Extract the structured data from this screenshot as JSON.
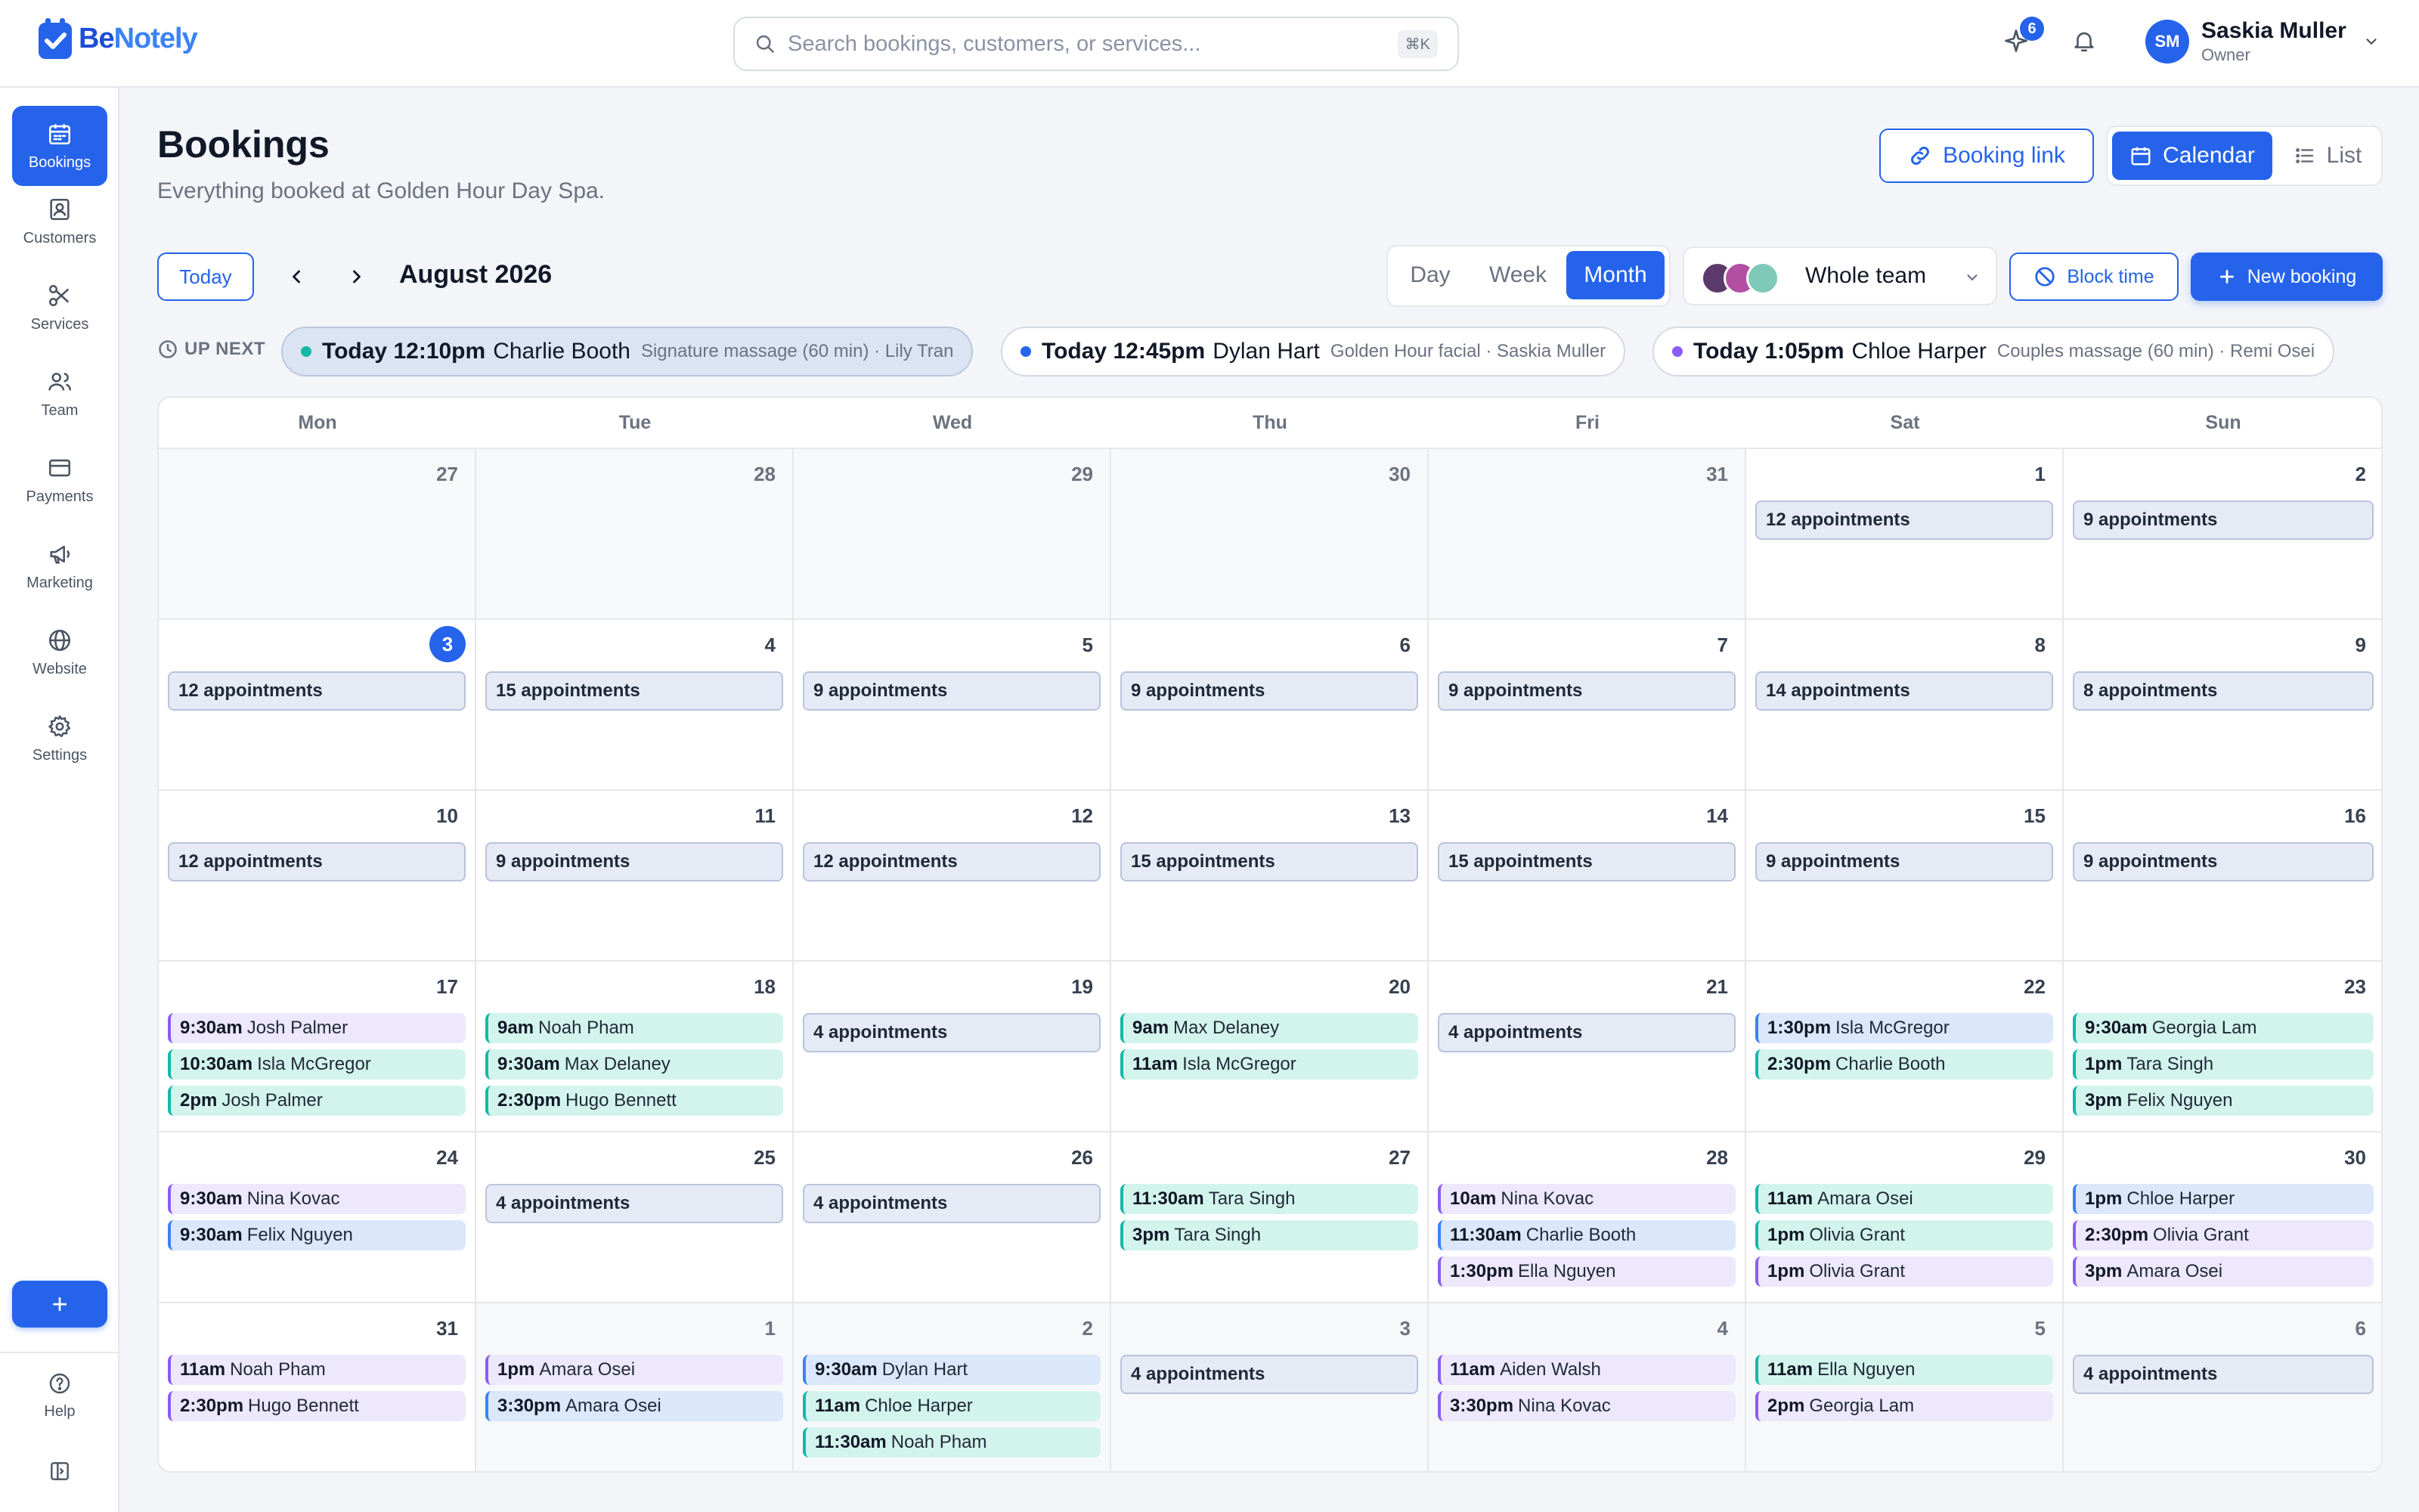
{
  "app": {
    "name_be": "Be",
    "name_notely": "Notely"
  },
  "search": {
    "placeholder": "Search bookings, customers, or services...",
    "shortcut": "⌘K"
  },
  "topbar": {
    "notification_count": "6"
  },
  "user": {
    "initials": "SM",
    "name": "Saskia Muller",
    "role": "Owner"
  },
  "sidebar": {
    "items": [
      {
        "label": "Bookings",
        "icon": "calendar-icon",
        "active": true
      },
      {
        "label": "Customers",
        "icon": "contact-card-icon"
      },
      {
        "label": "Services",
        "icon": "scissors-icon"
      },
      {
        "label": "Team",
        "icon": "users-icon"
      },
      {
        "label": "Payments",
        "icon": "credit-card-icon"
      },
      {
        "label": "Marketing",
        "icon": "megaphone-icon"
      },
      {
        "label": "Website",
        "icon": "globe-icon"
      },
      {
        "label": "Settings",
        "icon": "gear-icon"
      }
    ],
    "add_label": "+",
    "help_label": "Help"
  },
  "header": {
    "title": "Bookings",
    "subtitle": "Everything booked at Golden Hour Day Spa.",
    "booking_link": "Booking link",
    "view_calendar": "Calendar",
    "view_list": "List"
  },
  "toolbar": {
    "today": "Today",
    "month_label": "August 2026",
    "views": [
      "Day",
      "Week",
      "Month"
    ],
    "active_view": "Month",
    "team": "Whole team",
    "block_time": "Block time",
    "new_booking": "New booking"
  },
  "up_next": {
    "label": "UP NEXT",
    "items": [
      {
        "when": "Today 12:10pm",
        "who": "Charlie Booth",
        "what": "Signature massage (60 min) · Lily Tran",
        "color": "#14b8a6"
      },
      {
        "when": "Today 12:45pm",
        "who": "Dylan Hart",
        "what": "Golden Hour facial · Saskia Muller",
        "color": "#2563eb"
      },
      {
        "when": "Today 1:05pm",
        "who": "Chloe Harper",
        "what": "Couples massage (60 min) · Remi Osei",
        "color": "#8b5cf6"
      }
    ]
  },
  "calendar": {
    "weekdays": [
      "Mon",
      "Tue",
      "Wed",
      "Thu",
      "Fri",
      "Sat",
      "Sun"
    ],
    "weeks": [
      [
        {
          "day": "27",
          "muted": true
        },
        {
          "day": "28",
          "muted": true
        },
        {
          "day": "29",
          "muted": true
        },
        {
          "day": "30",
          "muted": true
        },
        {
          "day": "31",
          "muted": true
        },
        {
          "day": "1",
          "count": "12 appointments"
        },
        {
          "day": "2",
          "count": "9 appointments"
        }
      ],
      [
        {
          "day": "3",
          "today": true,
          "count": "12 appointments"
        },
        {
          "day": "4",
          "count": "15 appointments"
        },
        {
          "day": "5",
          "count": "9 appointments"
        },
        {
          "day": "6",
          "count": "9 appointments"
        },
        {
          "day": "7",
          "count": "9 appointments"
        },
        {
          "day": "8",
          "count": "14 appointments"
        },
        {
          "day": "9",
          "count": "8 appointments"
        }
      ],
      [
        {
          "day": "10",
          "count": "12 appointments"
        },
        {
          "day": "11",
          "count": "9 appointments"
        },
        {
          "day": "12",
          "count": "12 appointments"
        },
        {
          "day": "13",
          "count": "15 appointments"
        },
        {
          "day": "14",
          "count": "15 appointments"
        },
        {
          "day": "15",
          "count": "9 appointments"
        },
        {
          "day": "16",
          "count": "9 appointments"
        }
      ],
      [
        {
          "day": "17",
          "events": [
            {
              "time": "9:30am",
              "name": "Josh Palmer",
              "color": "purple"
            },
            {
              "time": "10:30am",
              "name": "Isla McGregor",
              "color": "teal"
            },
            {
              "time": "2pm",
              "name": "Josh Palmer",
              "color": "teal"
            }
          ]
        },
        {
          "day": "18",
          "events": [
            {
              "time": "9am",
              "name": "Noah Pham",
              "color": "teal"
            },
            {
              "time": "9:30am",
              "name": "Max Delaney",
              "color": "teal"
            },
            {
              "time": "2:30pm",
              "name": "Hugo Bennett",
              "color": "teal"
            }
          ]
        },
        {
          "day": "19",
          "count": "4 appointments"
        },
        {
          "day": "20",
          "events": [
            {
              "time": "9am",
              "name": "Max Delaney",
              "color": "teal"
            },
            {
              "time": "11am",
              "name": "Isla McGregor",
              "color": "teal"
            }
          ]
        },
        {
          "day": "21",
          "count": "4 appointments"
        },
        {
          "day": "22",
          "events": [
            {
              "time": "1:30pm",
              "name": "Isla McGregor",
              "color": "blue"
            },
            {
              "time": "2:30pm",
              "name": "Charlie Booth",
              "color": "teal"
            }
          ]
        },
        {
          "day": "23",
          "events": [
            {
              "time": "9:30am",
              "name": "Georgia Lam",
              "color": "teal"
            },
            {
              "time": "1pm",
              "name": "Tara Singh",
              "color": "teal"
            },
            {
              "time": "3pm",
              "name": "Felix Nguyen",
              "color": "teal"
            }
          ]
        }
      ],
      [
        {
          "day": "24",
          "events": [
            {
              "time": "9:30am",
              "name": "Nina Kovac",
              "color": "purple"
            },
            {
              "time": "9:30am",
              "name": "Felix Nguyen",
              "color": "blue"
            }
          ]
        },
        {
          "day": "25",
          "count": "4 appointments"
        },
        {
          "day": "26",
          "count": "4 appointments"
        },
        {
          "day": "27",
          "events": [
            {
              "time": "11:30am",
              "name": "Tara Singh",
              "color": "teal"
            },
            {
              "time": "3pm",
              "name": "Tara Singh",
              "color": "teal"
            }
          ]
        },
        {
          "day": "28",
          "events": [
            {
              "time": "10am",
              "name": "Nina Kovac",
              "color": "purple"
            },
            {
              "time": "11:30am",
              "name": "Charlie Booth",
              "color": "blue"
            },
            {
              "time": "1:30pm",
              "name": "Ella Nguyen",
              "color": "purple"
            }
          ]
        },
        {
          "day": "29",
          "events": [
            {
              "time": "11am",
              "name": "Amara Osei",
              "color": "teal"
            },
            {
              "time": "1pm",
              "name": "Olivia Grant",
              "color": "teal"
            },
            {
              "time": "1pm",
              "name": "Olivia Grant",
              "color": "purple"
            }
          ]
        },
        {
          "day": "30",
          "events": [
            {
              "time": "1pm",
              "name": "Chloe Harper",
              "color": "blue"
            },
            {
              "time": "2:30pm",
              "name": "Olivia Grant",
              "color": "purple"
            },
            {
              "time": "3pm",
              "name": "Amara Osei",
              "color": "purple"
            }
          ]
        }
      ],
      [
        {
          "day": "31",
          "events": [
            {
              "time": "11am",
              "name": "Noah Pham",
              "color": "purple"
            },
            {
              "time": "2:30pm",
              "name": "Hugo Bennett",
              "color": "purple"
            }
          ]
        },
        {
          "day": "1",
          "muted": true,
          "events": [
            {
              "time": "1pm",
              "name": "Amara Osei",
              "color": "purple"
            },
            {
              "time": "3:30pm",
              "name": "Amara Osei",
              "color": "blue"
            }
          ]
        },
        {
          "day": "2",
          "muted": true,
          "events": [
            {
              "time": "9:30am",
              "name": "Dylan Hart",
              "color": "blue"
            },
            {
              "time": "11am",
              "name": "Chloe Harper",
              "color": "teal"
            },
            {
              "time": "11:30am",
              "name": "Noah Pham",
              "color": "teal"
            }
          ]
        },
        {
          "day": "3",
          "muted": true,
          "count": "4 appointments"
        },
        {
          "day": "4",
          "muted": true,
          "events": [
            {
              "time": "11am",
              "name": "Aiden Walsh",
              "color": "purple"
            },
            {
              "time": "3:30pm",
              "name": "Nina Kovac",
              "color": "purple"
            }
          ]
        },
        {
          "day": "5",
          "muted": true,
          "events": [
            {
              "time": "11am",
              "name": "Ella Nguyen",
              "color": "teal"
            },
            {
              "time": "2pm",
              "name": "Georgia Lam",
              "color": "purple"
            }
          ]
        },
        {
          "day": "6",
          "muted": true,
          "count": "4 appointments"
        }
      ]
    ]
  },
  "colors": {
    "accent": "#2563eb",
    "teal": "#14b8a6",
    "purple": "#8b5cf6",
    "blue": "#3b82f6"
  }
}
